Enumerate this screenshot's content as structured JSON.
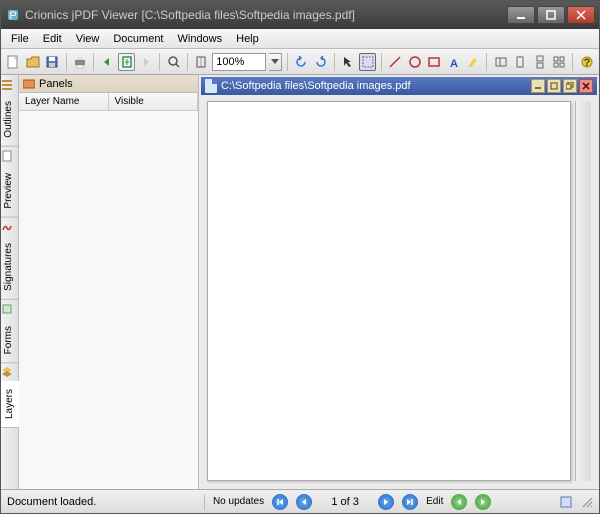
{
  "titlebar": {
    "app_name": "Crionics jPDF Viewer",
    "document_path": "C:\\Softpedia files\\Softpedia images.pdf",
    "full_title": "Crionics jPDF Viewer [C:\\Softpedia files\\Softpedia images.pdf]"
  },
  "menu": {
    "items": [
      "File",
      "Edit",
      "View",
      "Document",
      "Windows",
      "Help"
    ]
  },
  "toolbar": {
    "zoom_value": "100%"
  },
  "panels": {
    "title": "Panels",
    "columns": [
      "Layer Name",
      "Visible"
    ]
  },
  "side_tabs": [
    "Outlines",
    "Preview",
    "Signatures",
    "Forms",
    "Layers"
  ],
  "doc_tab": {
    "path": "C:\\Softpedia files\\Softpedia images.pdf"
  },
  "statusbar": {
    "message": "Document loaded.",
    "updates": "No updates",
    "page_label": "1 of 3",
    "edit": "Edit"
  }
}
